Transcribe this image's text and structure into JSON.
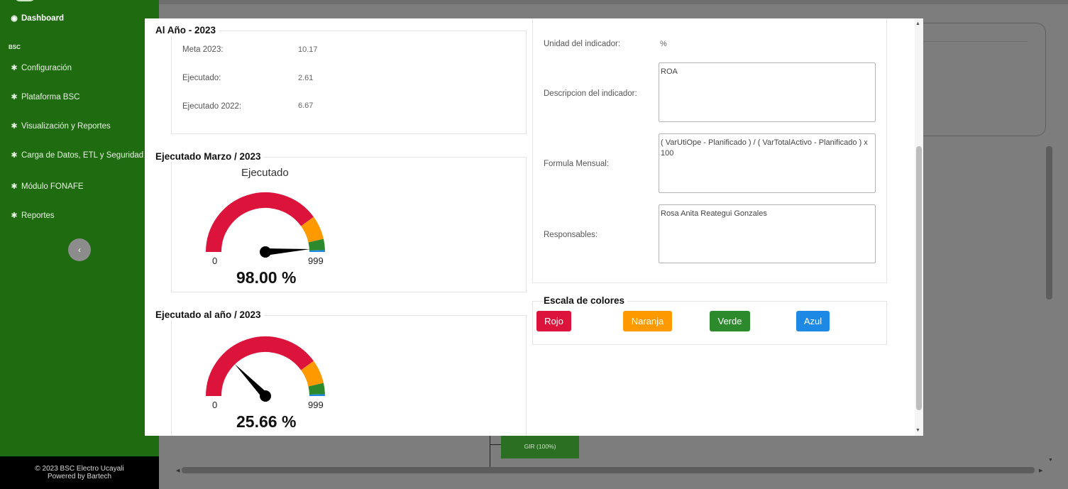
{
  "sidebar": {
    "dashboard": "Dashboard",
    "section": "BSC",
    "items": [
      "Configuración",
      "Plataforma BSC",
      "Visualización y Reportes",
      "Carga de Datos, ETL y Seguridad",
      "Módulo FONAFE",
      "Reportes"
    ],
    "collapse_glyph": "‹",
    "footer_line1": "© 2023 BSC Electro Ucayali",
    "footer_line2": "Powered by Bartech"
  },
  "background": {
    "gir_label": "GIR (100%)"
  },
  "annual": {
    "title": "Al Año - 2023",
    "rows": [
      {
        "label": "Meta 2023:",
        "value": "10.17"
      },
      {
        "label": "Ejecutado:",
        "value": "2.61"
      },
      {
        "label": "Ejecutado 2022:",
        "value": "6.67"
      }
    ]
  },
  "gauge_month": {
    "card_title": "Ejecutado Marzo / 2023",
    "title": "Ejecutado",
    "min": "0",
    "max": "999",
    "value_text": "98.00 %",
    "needle_fraction": 0.98
  },
  "gauge_year": {
    "card_title": "Ejecutado al año / 2023",
    "min": "0",
    "max": "999",
    "value_text": "25.66 %",
    "needle_fraction": 0.2566
  },
  "gauge_colors": {
    "red": "#dc143c",
    "orange": "#ff9900",
    "green": "#2c8a2c",
    "blue": "#1e88e5"
  },
  "indicator": {
    "unit_label": "Unidad del indicador:",
    "unit_value": "%",
    "desc_label": "Descripcion del indicador:",
    "desc_value": "ROA",
    "formula_label": "Formula Mensual:",
    "formula_value": "( VarUtiOpe - Planificado ) / ( VarTotalActivo  - Planificado ) x 100",
    "resp_label": "Responsables:",
    "resp_value": "Rosa Anita Reategui Gonzales"
  },
  "scale": {
    "title": "Escala de colores",
    "buttons": [
      {
        "label": "Rojo",
        "color": "#dc143c"
      },
      {
        "label": "Naranja",
        "color": "#ff9900"
      },
      {
        "label": "Verde",
        "color": "#2c8a2c"
      },
      {
        "label": "Azul",
        "color": "#1e88e5"
      }
    ]
  }
}
